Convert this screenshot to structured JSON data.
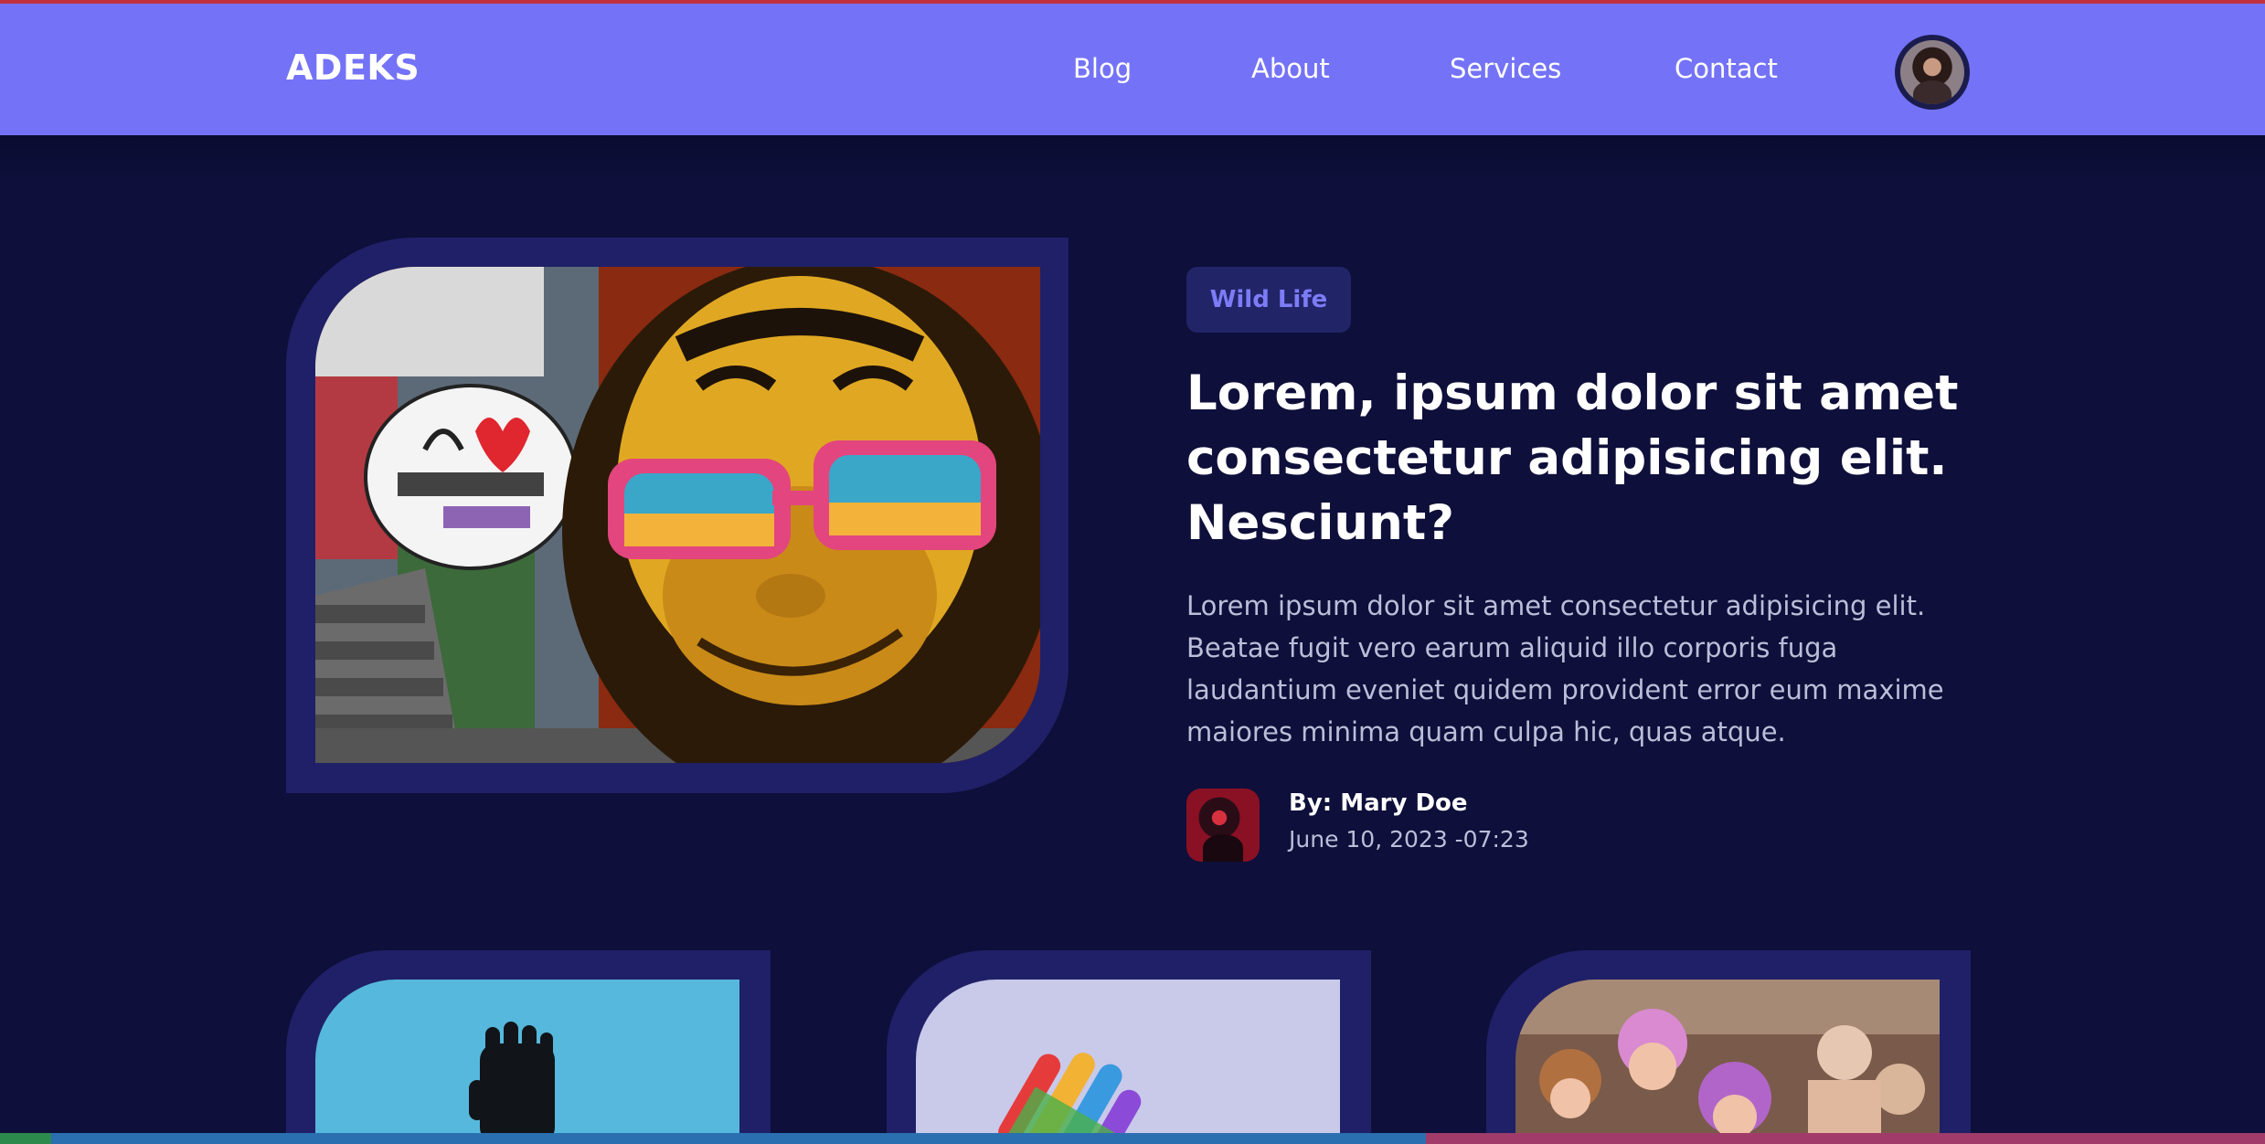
{
  "header": {
    "logo": "ADEKS",
    "nav": [
      {
        "label": "Blog"
      },
      {
        "label": "About"
      },
      {
        "label": "Services"
      },
      {
        "label": "Contact"
      }
    ]
  },
  "hero": {
    "tag": "Wild Life",
    "title": "Lorem, ipsum dolor sit amet consectetur adipisicing elit. Nesciunt?",
    "excerpt": "Lorem ipsum dolor sit amet consectetur adipisicing elit. Beatae fugit vero earum aliquid illo corporis fuga laudantium eveniet quidem provident error eum maxime maiores minima quam culpa hic, quas atque.",
    "author": "By: Mary Doe",
    "date": "June 10, 2023 -07:23"
  },
  "colors": {
    "background": "#0e0f3a",
    "navbar": "#7473f7",
    "frame": "#1f2067",
    "tag_text": "#7d7cf7"
  }
}
